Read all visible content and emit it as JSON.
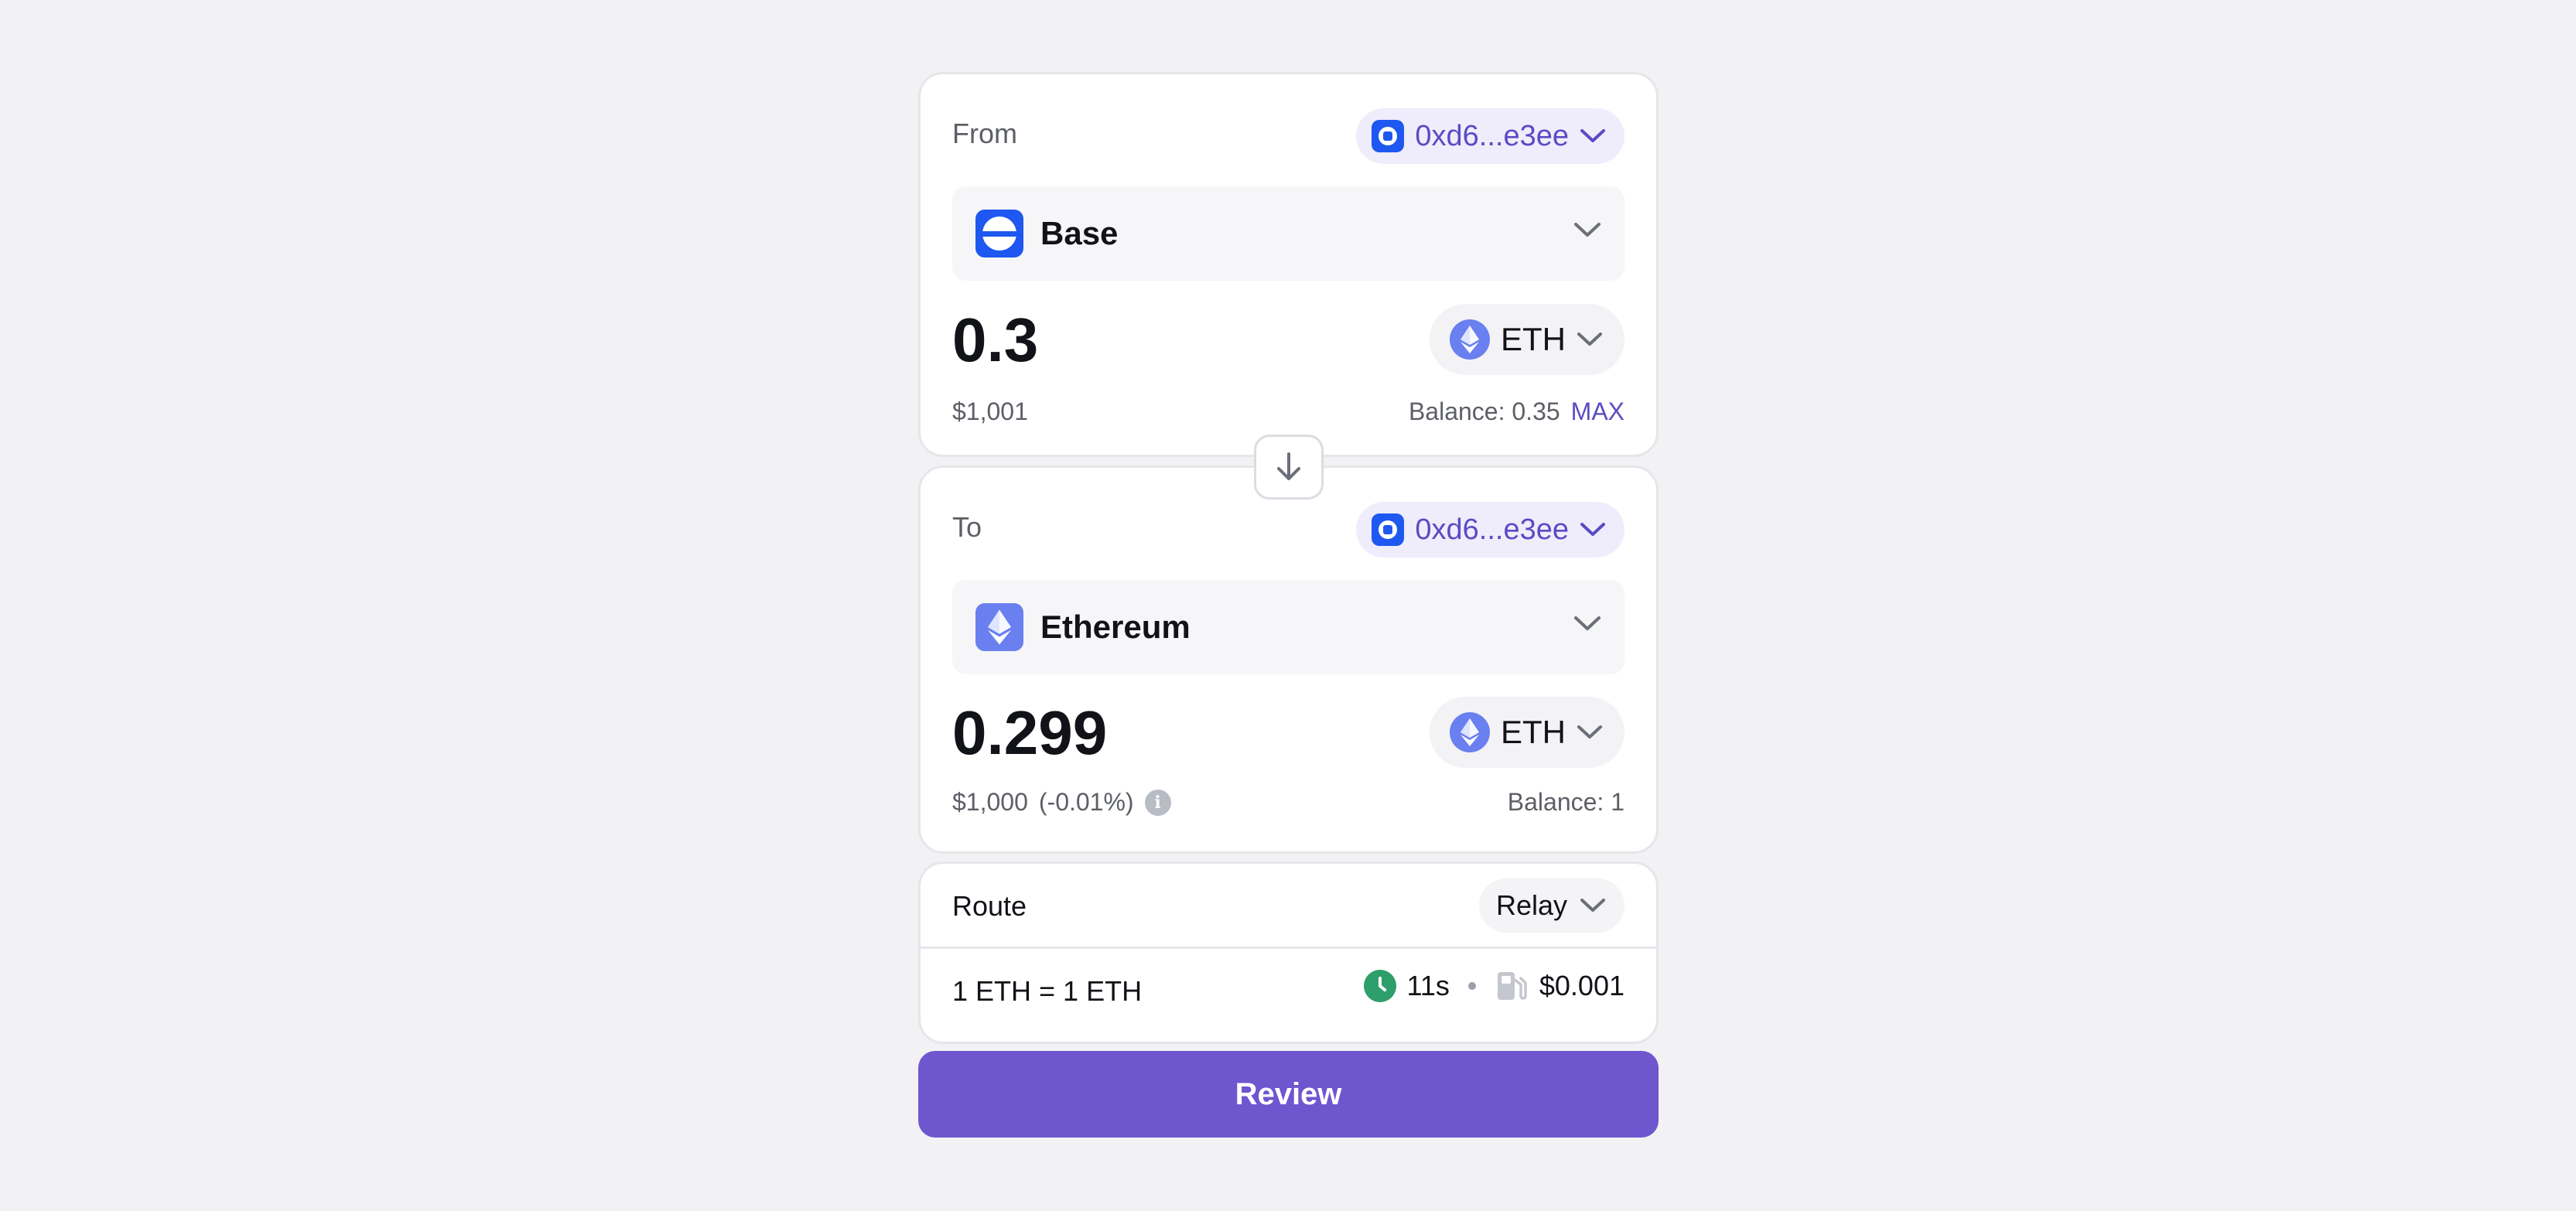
{
  "from": {
    "label": "From",
    "wallet": "0xd6...e3ee",
    "chain": "Base",
    "amount": "0.3",
    "token": "ETH",
    "usd_value": "$1,001",
    "balance": "Balance: 0.35",
    "max_label": "MAX"
  },
  "to": {
    "label": "To",
    "wallet": "0xd6...e3ee",
    "chain": "Ethereum",
    "amount": "0.299",
    "token": "ETH",
    "usd_value": "$1,000",
    "price_impact": "(-0.01%)",
    "balance": "Balance: 1"
  },
  "route": {
    "label": "Route",
    "provider": "Relay",
    "rate": "1 ETH = 1 ETH",
    "time": "11s",
    "fee": "$0.001"
  },
  "review_label": "Review",
  "colors": {
    "accent": "#6e56cf",
    "wallet_text": "#5b4bc4",
    "base_blue": "#1e58f0",
    "eth": "#6a7ff0",
    "clock_green": "#2e9e6a"
  },
  "icons": [
    "wallet-icon",
    "base-logo-icon",
    "ethereum-logo-icon",
    "chevron-down-icon",
    "arrow-down-icon",
    "info-icon",
    "clock-icon",
    "gas-pump-icon"
  ]
}
